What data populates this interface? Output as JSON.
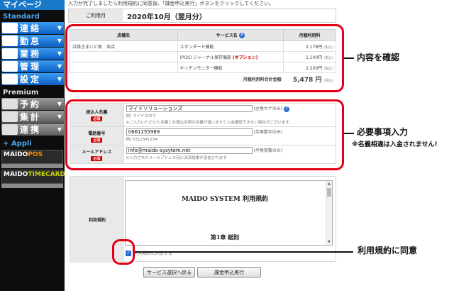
{
  "sidebar": {
    "top_label": "マイページ",
    "standard_label": "Standard",
    "standard_items": [
      {
        "label": "連絡"
      },
      {
        "label": "勤怠"
      },
      {
        "label": "業務"
      },
      {
        "label": "管理"
      },
      {
        "label": "設定"
      }
    ],
    "premium_label": "Premium",
    "premium_items": [
      {
        "label": "予約"
      },
      {
        "label": "集計"
      },
      {
        "label": "連携"
      }
    ],
    "appli_label": "+ Appli",
    "apps": [
      {
        "brand": "MAIDO",
        "accent": "POS"
      },
      {
        "brand": "MAIDO",
        "accent": "TIMECARD"
      }
    ]
  },
  "main": {
    "intro_text": "入力が完了しましたら利用規約に同意後、「課金申込実行」ボタンをクリックしてください。",
    "use_month_label": "ご利用月",
    "use_month_value": "2020年10月（翌月分）",
    "services_table": {
      "headers": [
        "店舗名",
        "サービス名",
        "月額利用料"
      ],
      "rows": [
        {
          "store": "浜焼きまいど家　本店",
          "service": "スタンダード機能",
          "option": "",
          "price": "2,178円",
          "tax": "(税込)"
        },
        {
          "store": "",
          "service": "(POS) ジャーナル保存機能",
          "option": "(オプション)",
          "price": "1,100円",
          "tax": "(税込)"
        },
        {
          "store": "",
          "service": "キッチンモニター機能",
          "option": "",
          "price": "2,200円",
          "tax": "(税込)"
        }
      ],
      "total_label": "月額利用料合計金額",
      "total_value": "5,478 円",
      "total_tax": "(税込)"
    },
    "form": {
      "required_badge": "必須",
      "name": {
        "label": "振込人名義",
        "value": "マイドソリューションズ",
        "hint": "(全角カナのみ)",
        "example": "例) マイドタロウ",
        "note": "※ご入力いただいた名義とお振込み時の名義が違いますと入金確認できない場合がございます。"
      },
      "phone": {
        "label": "電話番号",
        "value": "0661255989",
        "hint": "(半角数字のみ)",
        "example": "例) 0312341234"
      },
      "email": {
        "label": "メールアドレス",
        "value": "info@maido-sysytem.net",
        "hint": "(半角英数のみ)",
        "note": "※入力されたメールアドレス宛に決済結果が送信されます"
      }
    },
    "terms": {
      "label": "利用規約",
      "title": "MAIDO SYSTEM 利用規約",
      "chapter": "第1章 総則",
      "agree_label": "利用規約に同意する"
    },
    "buttons": {
      "back": "サービス選択へ戻る",
      "submit": "課金申込実行"
    }
  },
  "annotations": {
    "confirm": "内容を確認",
    "required": "必要事項入力",
    "note": "※名義相違は入金されません!",
    "agree": "利用規約に同意"
  },
  "colors": {
    "annotation_red": "#e10016",
    "nav_blue": "#0c5fc4",
    "required_red": "#d00000",
    "checkbox_blue": "#1f6fd6"
  }
}
